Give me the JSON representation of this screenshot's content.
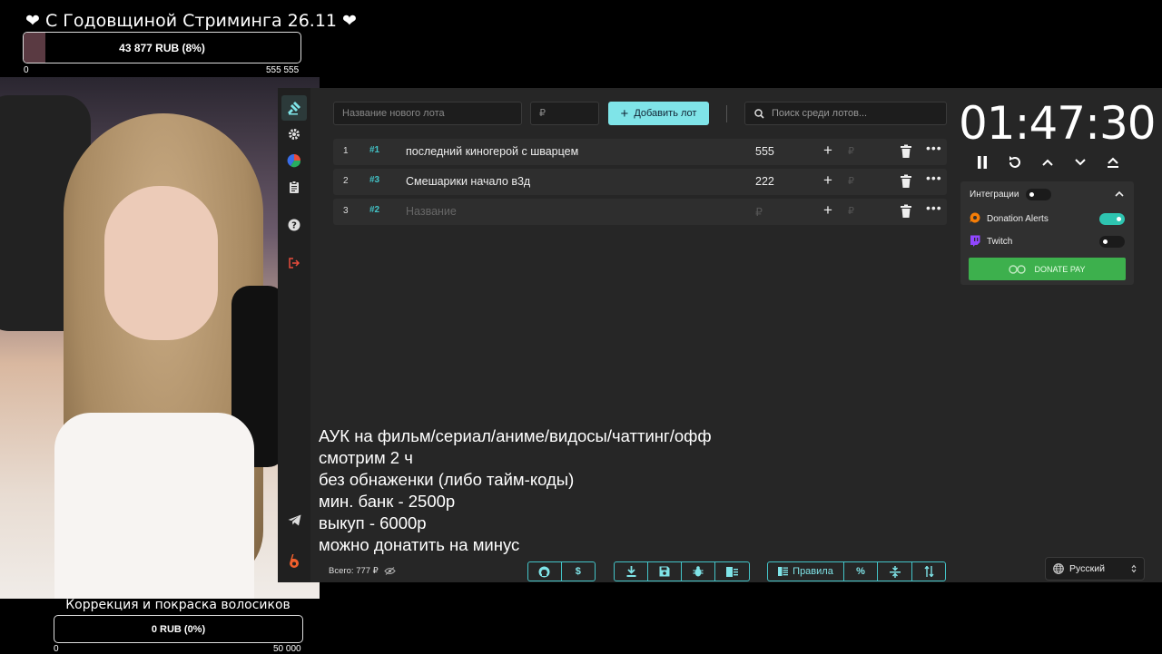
{
  "goal_top": {
    "title": "❤ С Годовщиной Стриминга 26.11 ❤",
    "progress_text": "43 877 RUB (8%)",
    "progress_fraction": 0.08,
    "scale_min": "0",
    "scale_max": "555 555"
  },
  "goal_bottom": {
    "title": "Коррекция и покраска волосиков",
    "progress_text": "0 RUB (0%)",
    "progress_fraction": 0,
    "scale_min": "0",
    "scale_max": "50 000"
  },
  "toolbar": {
    "new_lot_placeholder": "Название нового лота",
    "amount_placeholder": "₽",
    "add_lot_label": "Добавить лот",
    "search_placeholder": "Поиск среди лотов..."
  },
  "lots": [
    {
      "index": "1",
      "tag": "#1",
      "name": "последний киногерой с шварцем",
      "amount": "555"
    },
    {
      "index": "2",
      "tag": "#3",
      "name": "Смешарики начало в3д",
      "amount": "222"
    },
    {
      "index": "3",
      "tag": "#2",
      "name": "Название",
      "amount": "₽"
    }
  ],
  "row_icons": {
    "plus": "+",
    "rub": "₽",
    "more": "•••"
  },
  "timer": {
    "value": "01:47:30"
  },
  "integrations": {
    "title": "Интеграции",
    "items": [
      {
        "name": "Donation Alerts",
        "enabled": true,
        "color": "#f57d07"
      },
      {
        "name": "Twitch",
        "enabled": false,
        "color": "#9146ff"
      }
    ],
    "donatepay_label": "DONATE PAY"
  },
  "overlay_lines": [
    "АУК на фильм/сериал/аниме/видосы/чаттинг/офф",
    "смотрим 2 ч",
    "без обнаженки (либо тайм-коды)",
    "мин. банк - 2500р",
    "выкуп - 6000р",
    "можно донатить на минус"
  ],
  "footer": {
    "total": "Всего: 777 ₽",
    "rules_label": "Правила",
    "percent_label": "%",
    "language": "Русский"
  },
  "colors": {
    "accent": "#7fe4e8",
    "panel": "#262626",
    "row": "#2e2e2e",
    "donatepay": "#3db04d"
  }
}
